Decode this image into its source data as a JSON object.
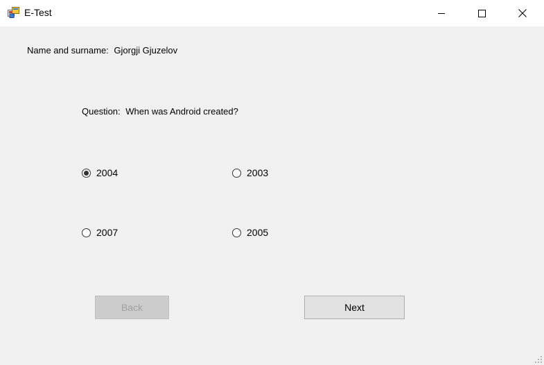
{
  "window": {
    "title": "E-Test",
    "icon": "windows-forms-app-icon",
    "controls": [
      "minimize-icon",
      "maximize-icon",
      "close-icon"
    ]
  },
  "student": {
    "label": "Name and surname:",
    "value": "Gjorgji Gjuzelov"
  },
  "question": {
    "label": "Question:",
    "text": "When was Android created?"
  },
  "answers": [
    {
      "label": "2004",
      "checked": true
    },
    {
      "label": "2003",
      "checked": false
    },
    {
      "label": "2007",
      "checked": false
    },
    {
      "label": "2005",
      "checked": false
    }
  ],
  "buttons": {
    "back": {
      "label": "Back",
      "enabled": false
    },
    "next": {
      "label": "Next",
      "enabled": true
    }
  }
}
